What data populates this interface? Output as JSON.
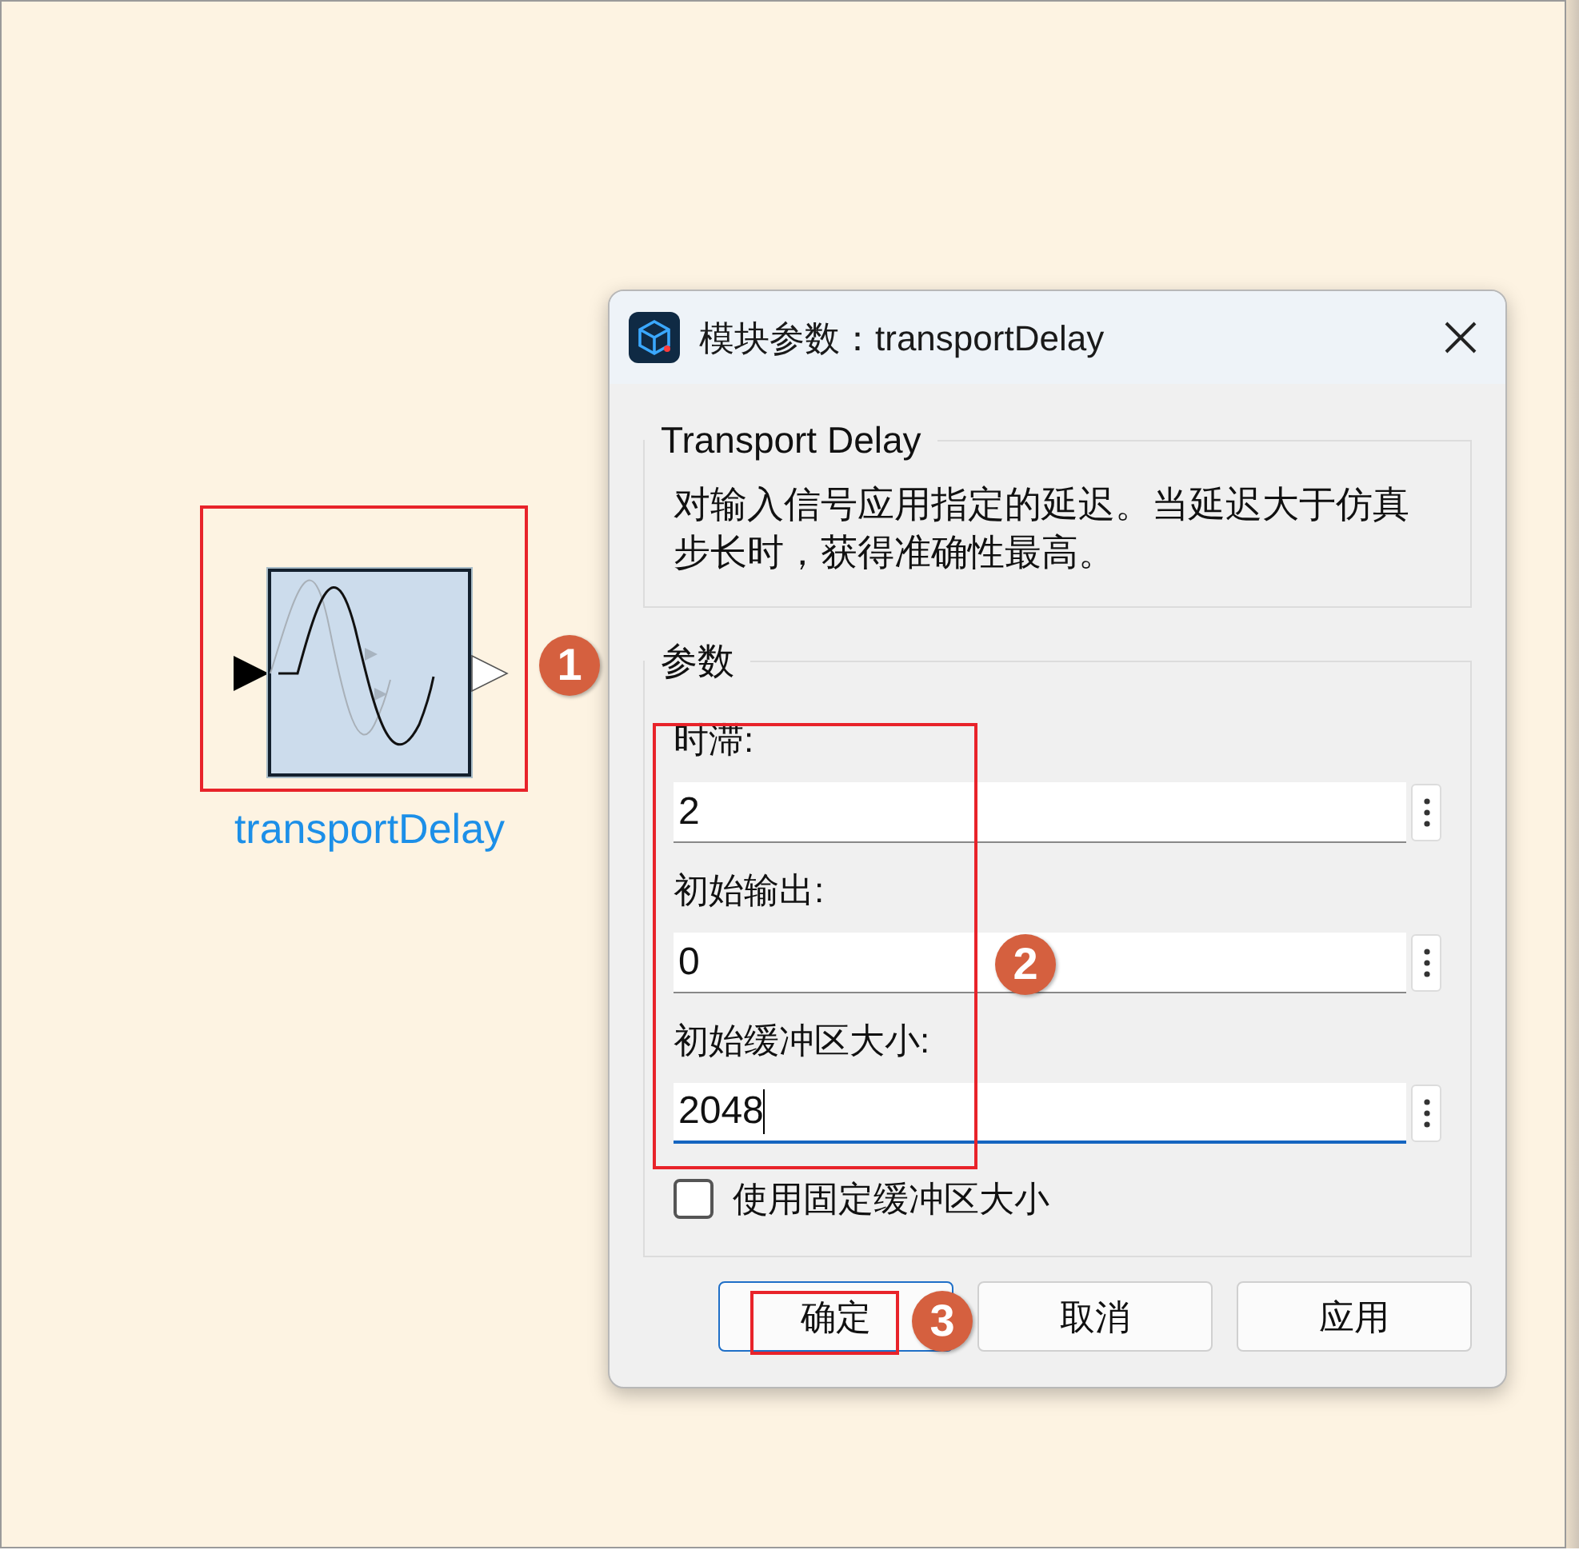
{
  "block": {
    "label": "transportDelay"
  },
  "dialog": {
    "title": "模块参数：transportDelay",
    "description_group": {
      "title": "Transport Delay",
      "text": "对输入信号应用指定的延迟。当延迟大于仿真步长时，获得准确性最高。"
    },
    "parameters_group": {
      "title": "参数",
      "fields": [
        {
          "label": "时滞:",
          "value": "2",
          "focused": false
        },
        {
          "label": "初始输出:",
          "value": "0",
          "focused": false
        },
        {
          "label": "初始缓冲区大小:",
          "value": "2048",
          "focused": true
        }
      ],
      "checkbox": {
        "label": "使用固定缓冲区大小",
        "checked": false
      }
    },
    "buttons": [
      {
        "label": "确定",
        "default": true
      },
      {
        "label": "取消",
        "default": false
      },
      {
        "label": "应用",
        "default": false
      }
    ]
  },
  "callouts": [
    "1",
    "2",
    "3"
  ]
}
